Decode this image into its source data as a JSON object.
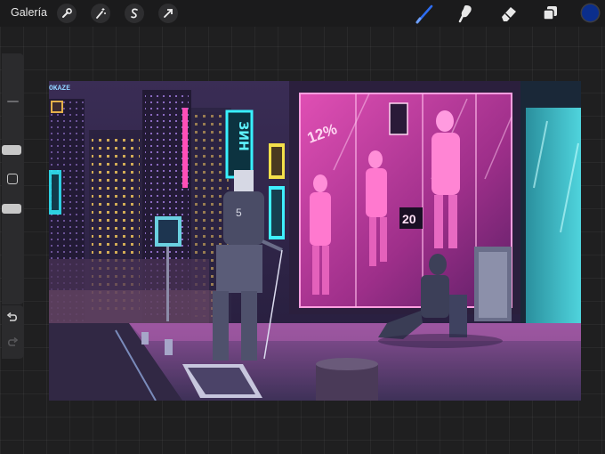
{
  "topbar": {
    "gallery_label": "Galería",
    "left_tools": [
      "wrench-icon",
      "magic-wand-icon",
      "selection-s-icon",
      "transform-arrow-icon"
    ],
    "right_tools": [
      "brush-icon",
      "smudge-icon",
      "eraser-icon",
      "layers-icon"
    ],
    "active_color": "#0b2e8c",
    "active_tool_color": "#2d6cf0"
  },
  "sidebar": {
    "controls": [
      "brush-size-slider",
      "modify-square-button",
      "opacity-slider",
      "undo-button",
      "redo-button"
    ]
  },
  "artwork": {
    "signature": "OKAZE",
    "sign_vertical": "ЗИН",
    "sign_discount": "12%",
    "sign_price": "20",
    "sign_number": "5"
  }
}
